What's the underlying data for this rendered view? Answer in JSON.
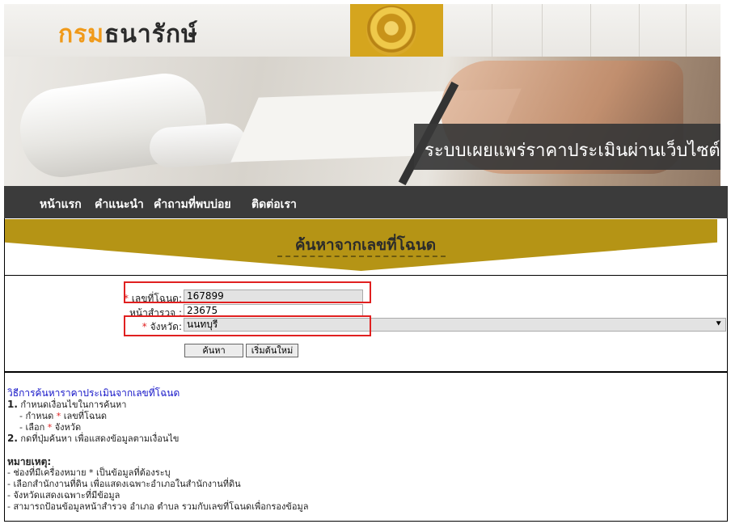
{
  "header": {
    "logo_part1": "กรม",
    "logo_part2": "ธนารักษ์",
    "banner_title": "ระบบเผยแพร่ราคาประเมินผ่านเว็บไซต์"
  },
  "nav": {
    "items": [
      "หน้าแรก",
      "คำแนะนำ",
      "คำถามที่พบบ่อย",
      "ติดต่อเรา"
    ]
  },
  "section_title": "ค้นหาจากเลขที่โฉนด",
  "form": {
    "deed_label": "เลขที่โฉนด:",
    "deed_value": "167899",
    "survey_label": "หน้าสำรวจ :",
    "survey_value": "23675",
    "province_label": "จังหวัด:",
    "province_value": "นนทบุรี",
    "search_button": "ค้นหา",
    "reset_button": "เริ่มต้นใหม่",
    "required_mark": "*"
  },
  "instructions": {
    "heading": "วิธีการค้นหาราคาประเมินจากเลขที่โฉนด",
    "step1_num": "1.",
    "step1": "กำหนดเงื่อนไขในการค้นหา",
    "step1a_pre": "- กำหนด",
    "step1a_post": "เลขที่โฉนด",
    "step1b_pre": "- เลือก",
    "step1b_post": "จังหวัด",
    "step2_num": "2.",
    "step2": "กดที่ปุ่มค้นหา เพื่อแสดงข้อมูลตามเงื่อนไข",
    "note_heading": "หมายเหตุ:",
    "notes": [
      "- ช่องที่มีเครื่องหมาย * เป็นข้อมูลที่ต้องระบุ",
      "- เลือกสำนักงานที่ดิน เพื่อแสดงเฉพาะอำเภอในสำนักงานที่ดิน",
      "- จังหวัดแสดงเฉพาะที่มีข้อมูล",
      "- สามารถป้อนข้อมูลหน้าสำรวจ อำเภอ ตำบล รวมกับเลขที่โฉนดเพื่อกรองข้อมูล"
    ]
  },
  "colors": {
    "accent_gold": "#b59415",
    "nav_bg": "#3b3b3b",
    "highlight": "#e02020",
    "logo_orange": "#f09a1a"
  }
}
